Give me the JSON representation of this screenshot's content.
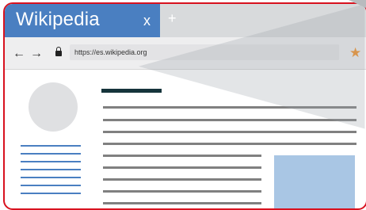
{
  "tab": {
    "title": "Wikipedia",
    "close_label": "x",
    "new_tab_label": "+"
  },
  "toolbar": {
    "back_label": "←",
    "forward_label": "→",
    "url": "https://es.wikipedia.org",
    "bookmark_icon": "star-icon"
  },
  "colors": {
    "frame_border": "#d8121f",
    "tab_active": "#4a7fc1",
    "bookmark_star": "#f0902a",
    "sidebar_links": "#4a7fc1",
    "image_placeholder": "#a9c6e4"
  }
}
